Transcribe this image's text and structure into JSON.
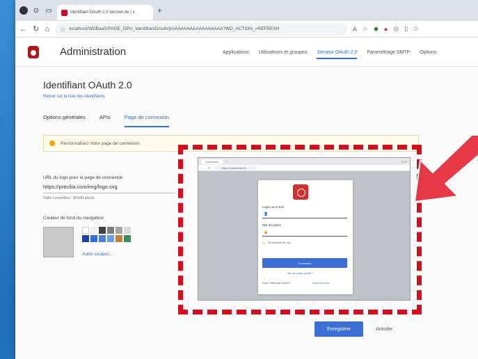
{
  "browser": {
    "tab_title": "Identifiant OAuth 2.0 Version de | x",
    "url": "localhost/WDBaaS/PAGE_GPU_IdentifiantOAuth/pUAAAAAAAAAAAAAAAA?WD_ACTION_=REFRESH"
  },
  "app": {
    "title": "Administration",
    "menu": [
      "Applications",
      "Utilisateurs et groupes",
      "Serveur OAuth 2.0",
      "Paramétrage SMTP",
      "Options"
    ]
  },
  "page": {
    "title": "Identifiant OAuth 2.0",
    "back_link": "Retour sur la liste des identifiants",
    "tabs": [
      "Options générales",
      "APIs",
      "Page de connexion"
    ],
    "info": "Personnalisez votre page de connexion",
    "logo_url_label": "URL du logo pour la page de connexion",
    "logo_url_value": "https://precilia.com/img/logo.svg",
    "logo_hint": "Taille conseillée : 80x80 pixels",
    "bg_color_label": "Couleur de fond du navigateur",
    "other_color": "Autre couleur..."
  },
  "preview": {
    "tab": "Connexion",
    "url": "https://unwebdev.fr/...",
    "login_label": "Login ou e-mail",
    "password_label": "Mot de passe",
    "remember": "Se souvenir de moi",
    "connect": "Connexion",
    "forgot": "Mot de passe oublié ?",
    "no_account": "Vous n'êtes pas inscrit ?",
    "signup": "Inscrivez-vous"
  },
  "actions": {
    "save": "Enregistrer",
    "cancel": "Annuler"
  },
  "colors": {
    "accent": "#3b6fd6",
    "highlight": "#d40e1f",
    "palette": [
      "#ffffff",
      "#f2f2f2",
      "#404040",
      "#7f7f7f",
      "#a6a6a6",
      "#d9d9d9",
      "#1f3fa8",
      "#2f6fd6",
      "#4f7fcf",
      "#6aa0e0",
      "#c5803c",
      "#3d8b5a"
    ]
  }
}
